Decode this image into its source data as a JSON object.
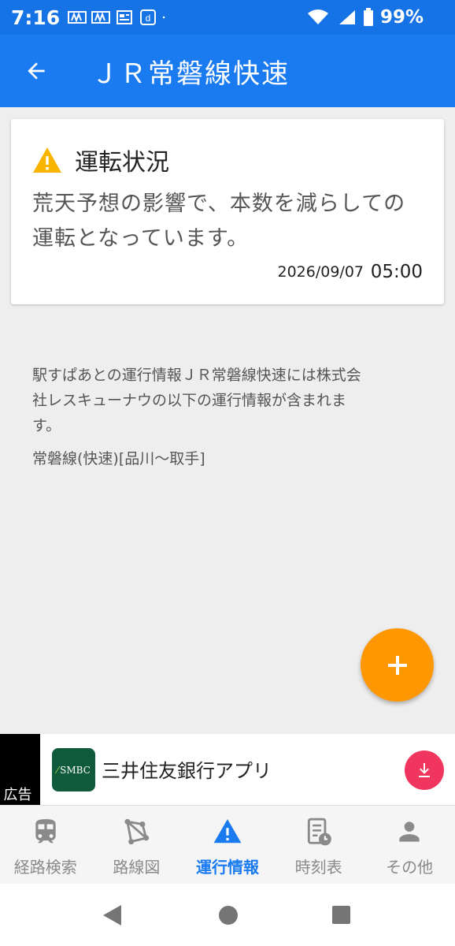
{
  "status": {
    "time": "7:16",
    "battery": "99%"
  },
  "appbar": {
    "title": "ＪＲ常磐線快速"
  },
  "card": {
    "heading": "運転状況",
    "message": "荒天予想の影響で、本数を減らしての運転となっています。",
    "date": "2026/09/07",
    "time": "05:00"
  },
  "info": {
    "attribution": "駅すぱあとの運行情報ＪＲ常磐線快速には株式会社レスキューナウの以下の運行情報が含まれます。",
    "route": "常磐線(快速)[品川〜取手]"
  },
  "ad": {
    "label": "広告",
    "logo_text": "SMBC",
    "title": "三井住友銀行アプリ"
  },
  "bottom_nav": {
    "items": [
      {
        "label": "経路検索",
        "icon": "train-icon"
      },
      {
        "label": "路線図",
        "icon": "route-map-icon"
      },
      {
        "label": "運行情報",
        "icon": "warning-icon",
        "active": true
      },
      {
        "label": "時刻表",
        "icon": "timetable-icon"
      },
      {
        "label": "その他",
        "icon": "person-icon"
      }
    ]
  },
  "colors": {
    "primary": "#1a7bf0",
    "fab": "#ff9800",
    "warning": "#f9b400",
    "download": "#f0365f"
  }
}
